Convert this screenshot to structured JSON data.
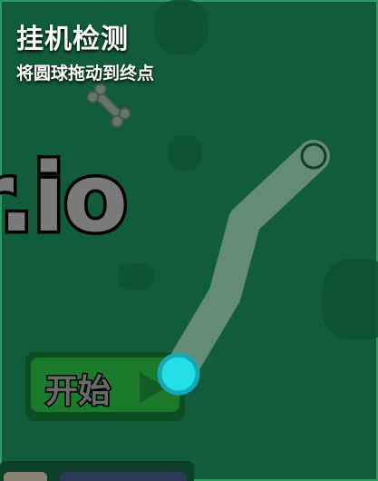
{
  "captcha": {
    "title": "挂机检测",
    "instruction": "将圆球拖动到终点"
  },
  "game": {
    "logo_text": "r.io",
    "start_label": "开始"
  },
  "colors": {
    "background": "#115c3a",
    "ball": "#22e0e6",
    "track": "#9aa79d"
  },
  "icons": [
    "bone-icon",
    "play-icon"
  ]
}
